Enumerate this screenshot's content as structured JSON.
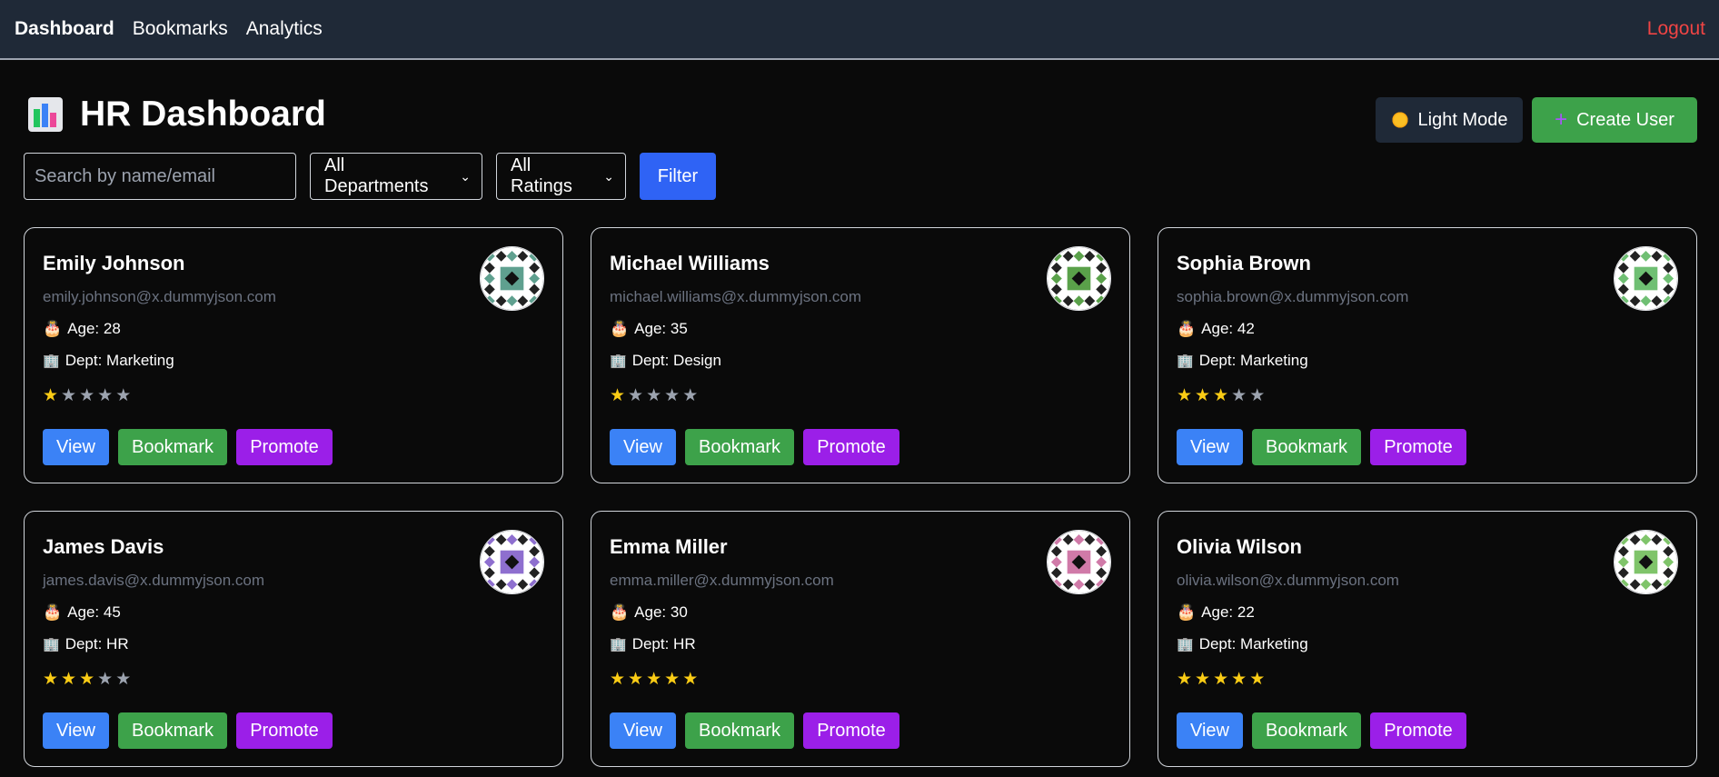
{
  "nav": {
    "dashboard": "Dashboard",
    "bookmarks": "Bookmarks",
    "analytics": "Analytics",
    "logout": "Logout"
  },
  "header": {
    "title": "HR Dashboard",
    "light_mode": "Light Mode",
    "create_user": "Create User"
  },
  "filters": {
    "search_placeholder": "Search by name/email",
    "department": "All Departments",
    "rating": "All Ratings",
    "filter_button": "Filter"
  },
  "labels": {
    "view": "View",
    "bookmark": "Bookmark",
    "promote": "Promote"
  },
  "users": [
    {
      "name": "Emily Johnson",
      "email": "emily.johnson@x.dummyjson.com",
      "age": "Age: 28",
      "dept": "Dept: Marketing",
      "rating": 1
    },
    {
      "name": "Michael Williams",
      "email": "michael.williams@x.dummyjson.com",
      "age": "Age: 35",
      "dept": "Dept: Design",
      "rating": 1
    },
    {
      "name": "Sophia Brown",
      "email": "sophia.brown@x.dummyjson.com",
      "age": "Age: 42",
      "dept": "Dept: Marketing",
      "rating": 3
    },
    {
      "name": "James Davis",
      "email": "james.davis@x.dummyjson.com",
      "age": "Age: 45",
      "dept": "Dept: HR",
      "rating": 3
    },
    {
      "name": "Emma Miller",
      "email": "emma.miller@x.dummyjson.com",
      "age": "Age: 30",
      "dept": "Dept: HR",
      "rating": 5
    },
    {
      "name": "Olivia Wilson",
      "email": "olivia.wilson@x.dummyjson.com",
      "age": "Age: 22",
      "dept": "Dept: Marketing",
      "rating": 5
    }
  ],
  "avatar_colors": [
    "#5fa08f",
    "#5aa14a",
    "#6fbf73",
    "#8e6fcf",
    "#d07aa8",
    "#7fc46a"
  ],
  "colors": {
    "nav_bg": "#1f2937",
    "view": "#3b82f6",
    "bookmark": "#3da24a",
    "promote": "#9b1fe8",
    "filter": "#2f63f5",
    "logout": "#ef4444",
    "star_on": "#facc15",
    "star_off": "#9ca3af"
  }
}
